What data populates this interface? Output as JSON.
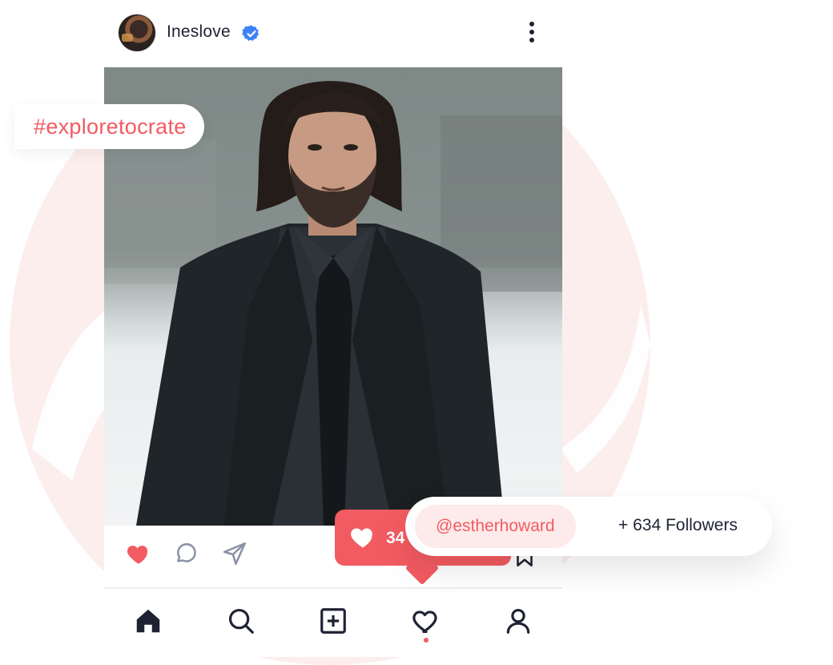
{
  "post": {
    "username": "Ineslove",
    "hashtag": "#exploretocrate",
    "photo_alt": "Post photo",
    "actions": {
      "like_icon": "heart-filled-icon",
      "comment_icon": "comment-bubble-icon",
      "share_icon": "paper-plane-icon",
      "save_icon": "bookmark-icon"
    }
  },
  "like_popup": {
    "count": "34"
  },
  "follow_card": {
    "handle": "@estherhoward",
    "followers": "+ 634 Followers"
  },
  "bottom_nav": {
    "items": [
      {
        "name": "home",
        "icon": "home-icon"
      },
      {
        "name": "search",
        "icon": "search-icon"
      },
      {
        "name": "create",
        "icon": "plus-square-icon"
      },
      {
        "name": "activity",
        "icon": "heart-outline-icon"
      },
      {
        "name": "profile",
        "icon": "user-icon"
      }
    ]
  },
  "colors": {
    "accent": "#f25b61",
    "accent_light": "#fdeaea",
    "text_dark": "#1f2233",
    "verified": "#3b82f6"
  }
}
